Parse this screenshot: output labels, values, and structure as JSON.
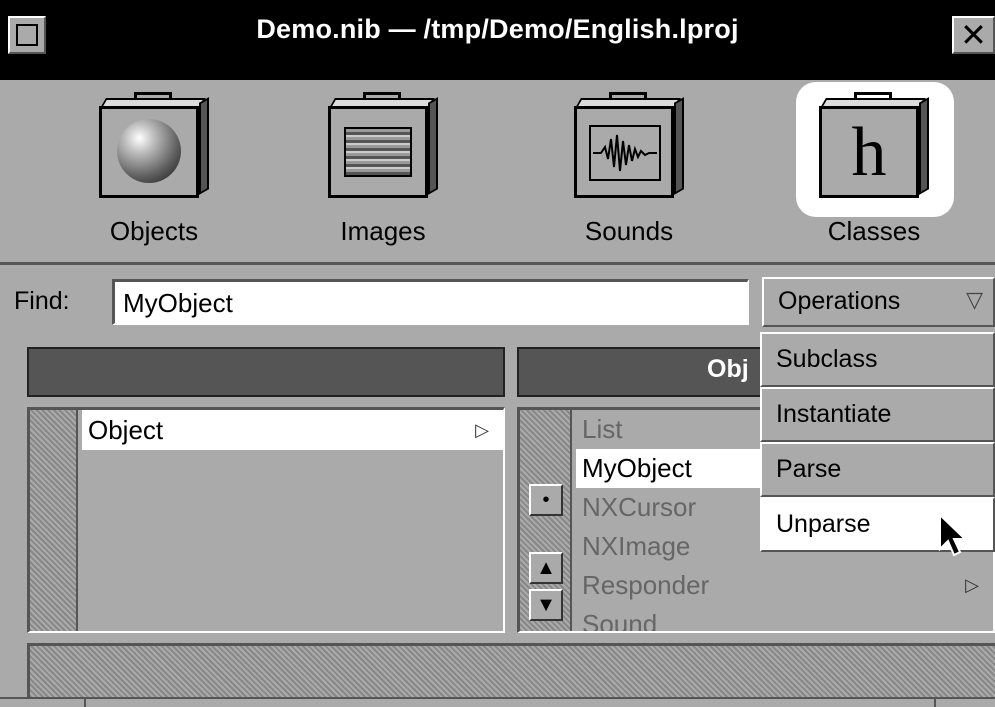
{
  "window": {
    "title": "Demo.nib — /tmp/Demo/English.lproj"
  },
  "shelf": {
    "items": [
      {
        "label": "Objects",
        "icon": "suitcase-sphere-icon"
      },
      {
        "label": "Images",
        "icon": "suitcase-picture-icon"
      },
      {
        "label": "Sounds",
        "icon": "suitcase-waveform-icon"
      },
      {
        "label": "Classes",
        "icon": "suitcase-letter-h-icon",
        "glyph": "h",
        "selected": true
      }
    ]
  },
  "find": {
    "label": "Find:",
    "value": "MyObject"
  },
  "operations": {
    "label": "Operations",
    "menu": [
      "Subclass",
      "Instantiate",
      "Parse",
      "Unparse"
    ],
    "highlighted": "Unparse"
  },
  "browser": {
    "left_column": {
      "header": "",
      "rows": [
        {
          "label": "Object",
          "has_children": true,
          "selected": true
        }
      ]
    },
    "right_column": {
      "header": "Obj",
      "rows": [
        {
          "label": "List",
          "dim": true
        },
        {
          "label": "MyObject",
          "selected": true
        },
        {
          "label": "NXCursor",
          "dim": true
        },
        {
          "label": "NXImage",
          "dim": true
        },
        {
          "label": "Responder",
          "dim": true,
          "has_children": true
        },
        {
          "label": "Sound",
          "dim": true
        }
      ]
    }
  },
  "colors": {
    "background": "#aaaaaa",
    "titlebar": "#000000",
    "header": "#555555",
    "selection": "#ffffff"
  }
}
